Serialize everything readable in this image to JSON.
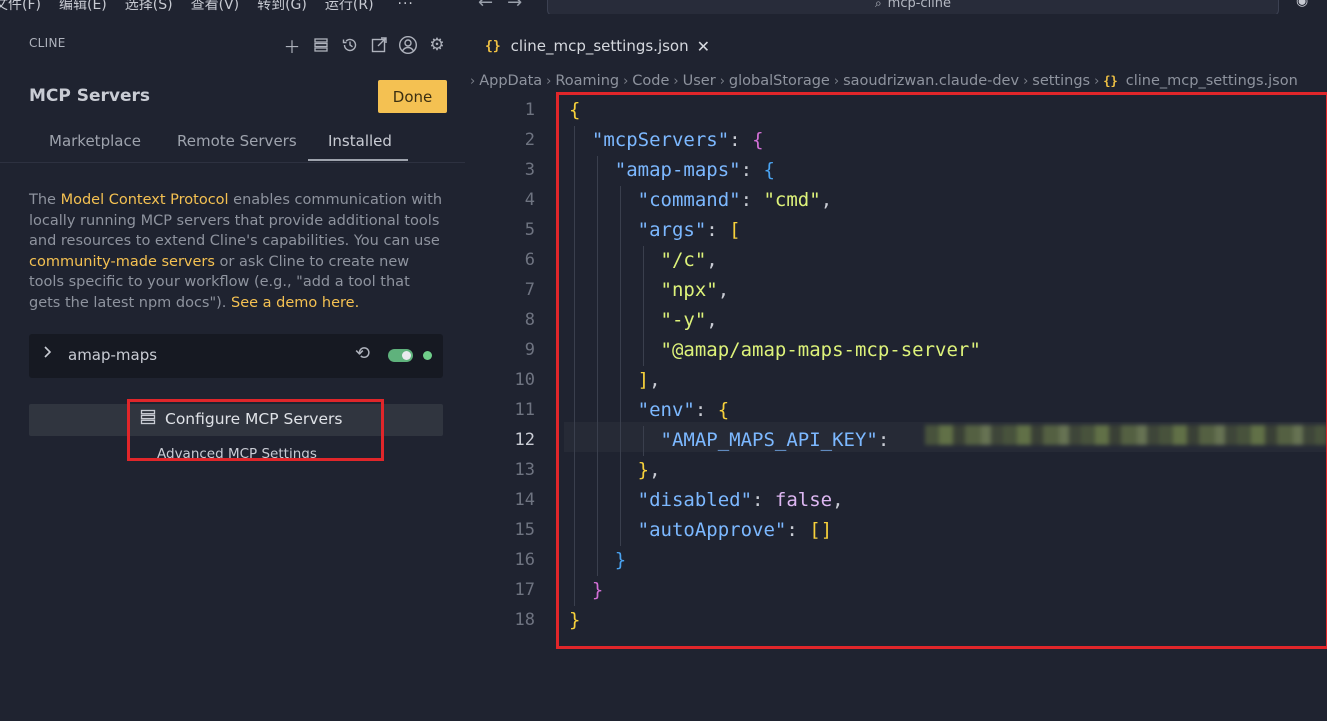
{
  "menubar": {
    "items": [
      "文件(F)",
      "编辑(E)",
      "选择(S)",
      "查看(V)",
      "转到(G)",
      "运行(R)"
    ],
    "more": "···"
  },
  "command_center": {
    "text": "mcp-cline"
  },
  "sidebar": {
    "header": "CLINE",
    "toolbar_icons": [
      "plus-icon",
      "server-icon",
      "history-icon",
      "external-link-icon",
      "account-icon",
      "gear-icon"
    ],
    "title": "MCP Servers",
    "done_label": "Done",
    "tabs": [
      "Marketplace",
      "Remote Servers",
      "Installed"
    ],
    "active_tab": "Installed",
    "description": {
      "t1": "The ",
      "link1": "Model Context Protocol",
      "t2": " enables communication with locally running MCP servers that provide additional tools and resources to extend Cline's capabilities. You can use ",
      "link2": "community-made servers",
      "t3": " or ask Cline to create new tools specific to your workflow (e.g., \"add a tool that gets the latest npm docs\"). ",
      "link3": "See a demo here."
    },
    "server": {
      "name": "amap-maps",
      "enabled": true,
      "status": "connected"
    },
    "configure_label": "Configure MCP Servers",
    "advanced_label": "Advanced MCP Settings"
  },
  "editor": {
    "tab_label": "cline_mcp_settings.json",
    "tab_icon": "{}",
    "breadcrumb": [
      "AppData",
      "Roaming",
      "Code",
      "User",
      "globalStorage",
      "saoudrizwan.claude-dev",
      "settings"
    ],
    "breadcrumb_file": "cline_mcp_settings.json",
    "current_line": 12,
    "line_numbers": [
      "1",
      "2",
      "3",
      "4",
      "5",
      "6",
      "7",
      "8",
      "9",
      "10",
      "11",
      "12",
      "13",
      "14",
      "15",
      "16",
      "17",
      "18"
    ],
    "code": {
      "mcpServers": "\"mcpServers\"",
      "amap_maps": "\"amap-maps\"",
      "command_key": "\"command\"",
      "command_val": "\"cmd\"",
      "args_key": "\"args\"",
      "arg1": "\"/c\"",
      "arg2": "\"npx\"",
      "arg3": "\"-y\"",
      "arg4": "\"@amap/amap-maps-mcp-server\"",
      "env_key": "\"env\"",
      "api_key": "\"AMAP_MAPS_API_KEY\"",
      "disabled_key": "\"disabled\"",
      "disabled_val": "false",
      "autoapprove_key": "\"autoApprove\""
    }
  },
  "colors": {
    "highlight_box": "#e0262a",
    "accent": "#f4c152",
    "toggle_on": "#5fb27c"
  }
}
